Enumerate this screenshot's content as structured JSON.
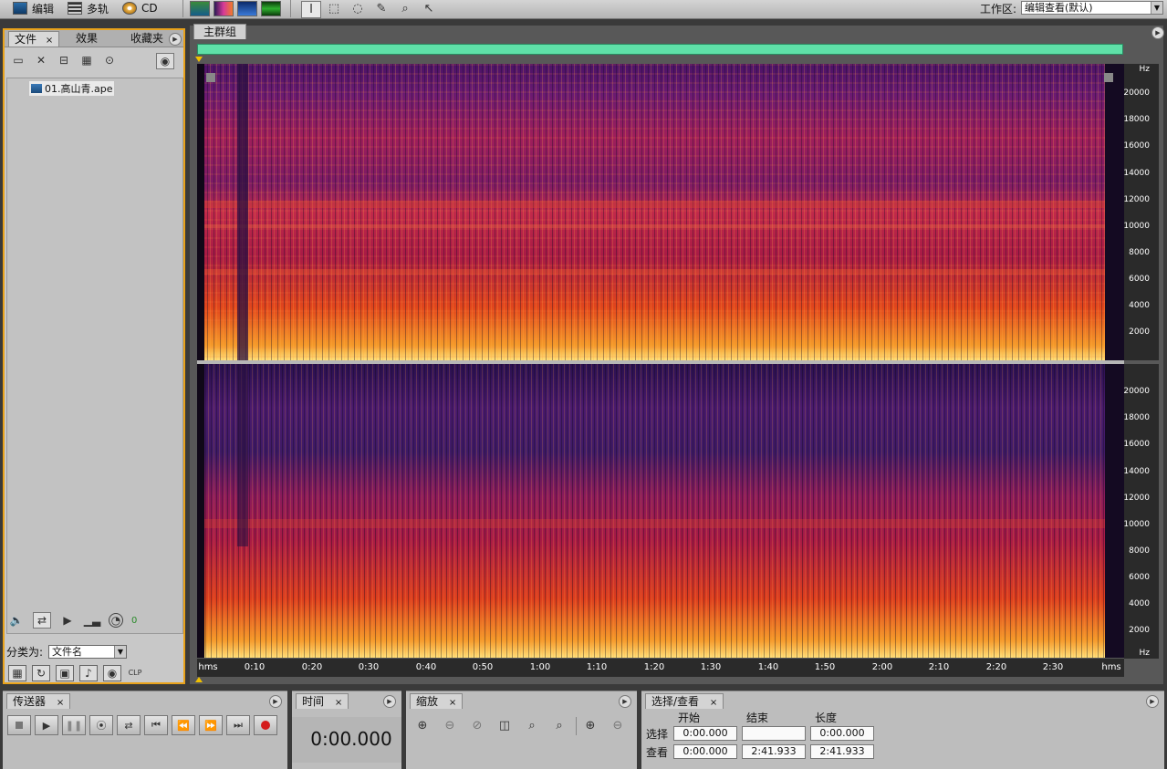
{
  "toolbar": {
    "modes": [
      {
        "label": "编辑",
        "icon": "waveform-edit-icon"
      },
      {
        "label": "多轨",
        "icon": "multitrack-icon"
      },
      {
        "label": "CD",
        "icon": "cd-icon"
      }
    ],
    "view_buttons": [
      "waveform-view-icon",
      "spectral-frequency-view-icon",
      "spectral-pan-view-icon",
      "spectral-phase-view-icon"
    ],
    "tools": [
      "time-selection-tool-icon",
      "marquee-tool-icon",
      "lasso-tool-icon",
      "brush-tool-icon",
      "spot-healing-tool-icon",
      "scrub-tool-icon"
    ],
    "workspace_label": "工作区:",
    "workspace_value": "编辑查看(默认)"
  },
  "left_panel": {
    "tabs": [
      "文件",
      "效果",
      "收藏夹"
    ],
    "files": [
      {
        "name": "01.高山青.ape"
      }
    ],
    "volume_value": "0",
    "sort_label": "分类为:",
    "sort_value": "文件名"
  },
  "main": {
    "tab": "主群组",
    "frequency_labels": [
      "Hz",
      "20000",
      "18000",
      "16000",
      "14000",
      "12000",
      "10000",
      "8000",
      "6000",
      "4000",
      "2000"
    ],
    "frequency_labels_ch2": [
      "20000",
      "18000",
      "16000",
      "14000",
      "12000",
      "10000",
      "8000",
      "6000",
      "4000",
      "2000",
      "Hz"
    ],
    "time_labels": [
      "hms",
      "0:10",
      "0:20",
      "0:30",
      "0:40",
      "0:50",
      "1:00",
      "1:10",
      "1:20",
      "1:30",
      "1:40",
      "1:50",
      "2:00",
      "2:10",
      "2:20",
      "2:30",
      "hms"
    ]
  },
  "transport": {
    "tab": "传送器",
    "buttons": [
      "stop-icon",
      "play-icon",
      "pause-icon",
      "play-to-end-icon",
      "loop-icon",
      "go-to-start-icon",
      "rewind-icon",
      "fast-forward-icon",
      "go-to-end-icon",
      "record-icon"
    ]
  },
  "time_panel": {
    "tab": "时间",
    "value": "0:00.000"
  },
  "zoom_panel": {
    "tab": "缩放"
  },
  "selection_panel": {
    "tab": "选择/查看",
    "headers": {
      "start": "开始",
      "end": "结束",
      "length": "长度"
    },
    "select_label": "选择",
    "view_label": "查看",
    "select_start": "0:00.000",
    "select_end": "",
    "select_length": "0:00.000",
    "view_start": "0:00.000",
    "view_end": "2:41.933",
    "view_length": "2:41.933"
  }
}
